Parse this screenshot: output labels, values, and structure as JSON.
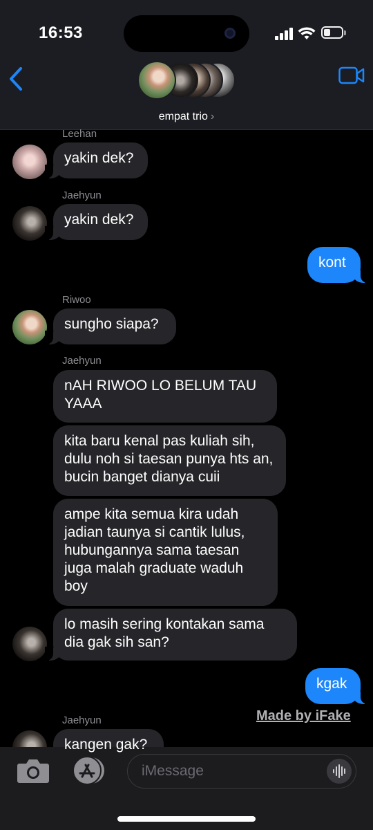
{
  "status": {
    "time": "16:53"
  },
  "header": {
    "group_name": "empat trio",
    "chevron": "›"
  },
  "messages": [
    {
      "sender": "Leehan",
      "text": "yakin dek?"
    },
    {
      "sender": "Jaehyun",
      "text": "yakin dek?"
    },
    {
      "sender": "me",
      "text": "kont"
    },
    {
      "sender": "Riwoo",
      "text": "sungho siapa?"
    },
    {
      "sender": "Jaehyun",
      "text": "nAH RIWOO LO BELUM TAU YAAA"
    },
    {
      "sender": "Jaehyun",
      "text": "kita baru kenal pas kuliah sih, dulu noh si taesan punya hts an, bucin banget dianya cuii"
    },
    {
      "sender": "Jaehyun",
      "text": "ampe kita semua kira udah jadian taunya si cantik lulus, hubungannya sama taesan juga malah graduate waduh boy"
    },
    {
      "sender": "Jaehyun",
      "text": "lo masih sering kontakan sama dia gak sih san?"
    },
    {
      "sender": "me",
      "text": "kgak"
    },
    {
      "sender": "Jaehyun",
      "text": "kangen gak?"
    }
  ],
  "watermark": "Made by iFake",
  "composer": {
    "placeholder": "iMessage"
  },
  "colors": {
    "accent": "#1c86fa",
    "bubble_incoming": "#26262a",
    "header_bg": "#1b1d22"
  },
  "icons": [
    "back-chevron-icon",
    "video-call-icon",
    "camera-icon",
    "app-store-icon",
    "audio-waveform-icon"
  ]
}
